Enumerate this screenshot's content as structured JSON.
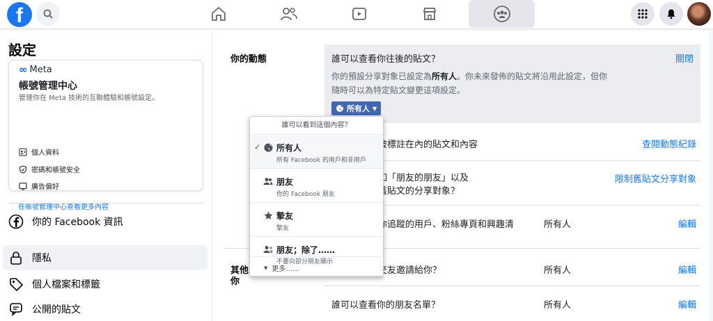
{
  "topbar": {
    "logo_letter": "f",
    "icons": [
      "search-icon",
      "home-icon",
      "friends-icon",
      "watch-icon",
      "marketplace-icon",
      "groups-icon",
      "menu-grid-icon",
      "notifications-bell-icon"
    ]
  },
  "sidebar": {
    "title": "設定",
    "meta_card": {
      "brand": "Meta",
      "title": "帳號管理中心",
      "description": "管理你在 Meta 技術的互聯體驗和帳號設定。",
      "items": [
        {
          "label": "個人資料",
          "icon": "id-card-icon"
        },
        {
          "label": "密碼和帳號安全",
          "icon": "shield-icon"
        },
        {
          "label": "廣告偏好",
          "icon": "monitor-icon"
        }
      ],
      "link": "在帳號管理中心查看更多內容"
    },
    "nav": [
      {
        "label": "你的 Facebook 資訊",
        "icon": "facebook-circle-icon"
      },
      {
        "label": "隱私",
        "icon": "lock-icon",
        "active": true
      },
      {
        "label": "個人檔案和標籤",
        "icon": "tag-icon"
      },
      {
        "label": "公開的貼文",
        "icon": "speech-bubble-icon"
      }
    ]
  },
  "main": {
    "section_activity": "你的動態",
    "section_other_line1": "其他",
    "section_other_line2": "你",
    "highlight": {
      "question": "誰可以查看你往後的貼文？",
      "close": "關閉",
      "desc_part1": "你的預設分享對象已設定為",
      "desc_bold": "所有人",
      "desc_part2": "。你未來發佈的貼文將沿用此設定，但你隨時可以為特定貼文變更這項設定。",
      "button_label": "所有人"
    },
    "rows": [
      {
        "text": "被標註在內的貼文和內容",
        "value": "",
        "link": "查閱動態紀錄"
      },
      {
        "text_line1": "如「朋友的朋友」以及",
        "text_line2": "舊貼文的分享對象？",
        "value": "",
        "link": "限制舊貼文分享對象"
      },
      {
        "text": "你追蹤的用戶、粉絲專頁和興趣清",
        "value": "所有人",
        "link": "編輯"
      },
      {
        "text": "交友邀請給你？",
        "value": "所有人",
        "link": "編輯"
      },
      {
        "text": "誰可以查看你的朋友名單？",
        "value": "所有人",
        "link": "編輯"
      }
    ]
  },
  "dropdown": {
    "header": "誰可以看到這個內容？",
    "options": [
      {
        "title": "所有人",
        "subtitle": "所有 Facebook 的用戶和非用戶",
        "icon": "globe-icon",
        "selected": true,
        "check": "✓"
      },
      {
        "title": "朋友",
        "subtitle": "你的 Facebook 朋友",
        "icon": "friends-icon",
        "selected": false
      },
      {
        "title": "摯友",
        "subtitle": "摯友",
        "icon": "star-icon",
        "selected": false
      },
      {
        "title": "朋友；除了……",
        "subtitle": "不要向部分朋友顯示",
        "icon": "friends-except-icon",
        "selected": false
      }
    ],
    "more": "更多……"
  }
}
